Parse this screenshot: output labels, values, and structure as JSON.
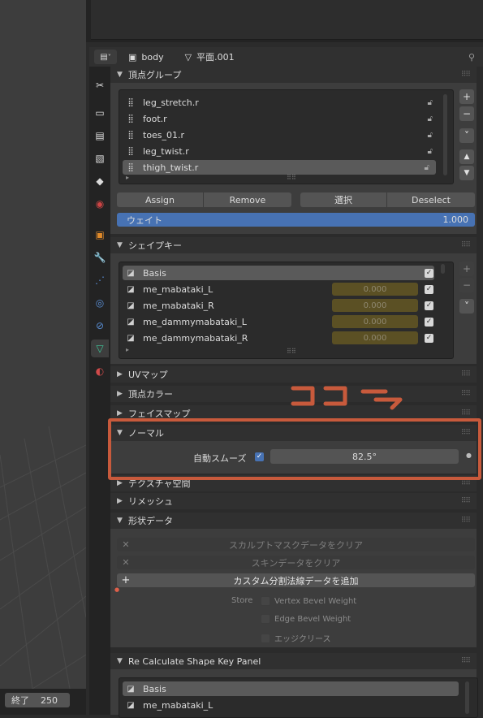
{
  "viewport": {
    "end_label": "終了",
    "end_value": "250"
  },
  "header": {
    "editor_icon": "properties-editor-icon",
    "object_name": "body",
    "mesh_name": "平面.001"
  },
  "tabs": [
    {
      "name": "tool-tab",
      "icon": "tool-icon"
    },
    {
      "name": "render-tab",
      "icon": "render-icon"
    },
    {
      "name": "output-tab",
      "icon": "output-icon"
    },
    {
      "name": "view-layer-tab",
      "icon": "view-layer-icon"
    },
    {
      "name": "scene-tab",
      "icon": "scene-icon"
    },
    {
      "name": "world-tab",
      "icon": "world-icon"
    },
    {
      "name": "object-tab",
      "icon": "object-icon"
    },
    {
      "name": "modifiers-tab",
      "icon": "wrench-icon"
    },
    {
      "name": "particles-tab",
      "icon": "particles-icon"
    },
    {
      "name": "physics-tab",
      "icon": "physics-icon"
    },
    {
      "name": "constraints-tab",
      "icon": "constraints-icon"
    },
    {
      "name": "data-tab",
      "icon": "mesh-data-icon",
      "active": true
    },
    {
      "name": "material-tab",
      "icon": "material-icon"
    }
  ],
  "vertex_groups": {
    "title": "頂点グループ",
    "items": [
      "leg_stretch.r",
      "foot.r",
      "toes_01.r",
      "leg_twist.r",
      "thigh_twist.r"
    ],
    "selected_index": 4,
    "buttons": {
      "assign": "Assign",
      "remove": "Remove",
      "select": "選択",
      "deselect": "Deselect"
    },
    "weight_label": "ウェイト",
    "weight_value": "1.000"
  },
  "shape_keys": {
    "title": "シェイプキー",
    "items": [
      {
        "name": "Basis",
        "value": ""
      },
      {
        "name": "me_mabataki_L",
        "value": "0.000"
      },
      {
        "name": "me_mabataki_R",
        "value": "0.000"
      },
      {
        "name": "me_dammymabataki_L",
        "value": "0.000"
      },
      {
        "name": "me_dammymabataki_R",
        "value": "0.000"
      }
    ]
  },
  "collapsed_panels": {
    "uv": "UVマップ",
    "vertex_colors": "頂点カラー",
    "face_maps": "フェイスマップ"
  },
  "normals": {
    "title": "ノーマル",
    "auto_smooth_label": "自動スムーズ",
    "auto_smooth_checked": true,
    "angle": "82.5°"
  },
  "texture_space": {
    "title": "テクスチャ空間"
  },
  "remesh": {
    "title": "リメッシュ"
  },
  "geometry_data": {
    "title": "形状データ",
    "clear_sculpt_mask": "スカルプトマスクデータをクリア",
    "clear_skin": "スキンデータをクリア",
    "add_custom_normals": "カスタム分割法線データを追加",
    "store_label": "Store",
    "store_options": [
      "Vertex Bevel Weight",
      "Edge Bevel Weight",
      "エッジクリース"
    ]
  },
  "recalc_panel": {
    "title": "Re Calculate Shape Key Panel",
    "items": [
      "Basis",
      "me_mabataki_L"
    ],
    "selected_index": 0
  },
  "annotation": {
    "text": "ココ",
    "color": "#c85a3c"
  },
  "colors": {
    "accent": "#4772b3",
    "highlight": "#c85a3c"
  }
}
